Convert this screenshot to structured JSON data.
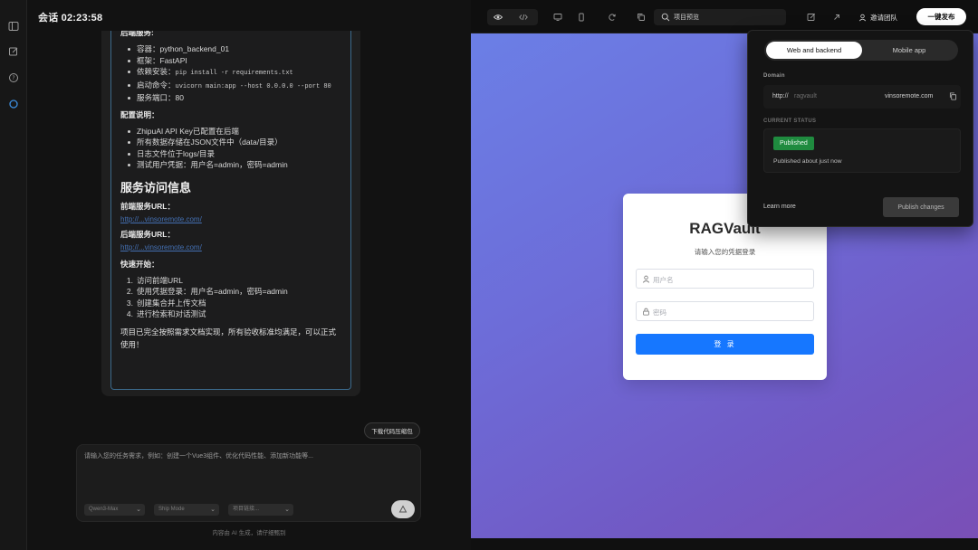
{
  "session": {
    "title": "会话 02:23:58"
  },
  "message": {
    "backend_heading": "后端服务:",
    "backend_items": [
      {
        "text": "容器：python_backend_01"
      },
      {
        "text": "框架：FastAPI"
      },
      {
        "prefix": "依赖安装：",
        "code": "pip install -r requirements.txt"
      },
      {
        "prefix": "启动命令：",
        "code": "uvicorn main:app --host 0.0.0.0 --port 80"
      },
      {
        "text": "服务端口：80"
      }
    ],
    "config_heading": "配置说明：",
    "config_items": [
      "ZhipuAI API Key已配置在后端",
      "所有数据存储在JSON文件中（data/目录）",
      "日志文件位于logs/目录",
      "测试用户凭据：用户名=admin，密码=admin"
    ],
    "service_heading": "服务访问信息",
    "frontend_url_label": "前端服务URL：",
    "frontend_url": "http://...vinsoremote.com/",
    "backend_url_label": "后端服务URL：",
    "backend_url": "http://...vinsoremote.com/",
    "quickstart_heading": "快速开始：",
    "quickstart_items": [
      "访问前端URL",
      "使用凭据登录：用户名=admin，密码=admin",
      "创建集合并上传文档",
      "进行检索和对话测试"
    ],
    "closing": "项目已完全按照需求文档实现，所有验收标准均满足，可以正式使用！"
  },
  "download_button": "下载代码压缩包",
  "composer": {
    "placeholder": "请输入您的任务需求，例如：创建一个Vue3组件、优化代码性能、添加新功能等...",
    "model_select": "Qwen3-Max",
    "mode_select": "Ship Mode",
    "project_select": "项目链接..."
  },
  "disclaimer": "内容由 AI 生成，请仔细甄别",
  "toolbar": {
    "address": "项目预览",
    "invite": "邀请团队",
    "publish": "一键发布"
  },
  "preview_app": {
    "title": "RAGVault",
    "subtitle": "请输入您的凭据登录",
    "username_placeholder": "用户名",
    "password_placeholder": "密码",
    "login_button": "登 录"
  },
  "publish_popover": {
    "tabs": [
      "Web and backend",
      "Mobile app"
    ],
    "active_tab": "Web and backend",
    "domain_label": "Domain",
    "domain_prefix": "http://",
    "domain_subdomain": "ragvault",
    "domain_suffix": "vinsoremote.com",
    "status_label": "CURRENT STATUS",
    "status_badge": "Published",
    "status_note": "Published about just now",
    "learn_more": "Learn more",
    "publish_changes": "Publish changes"
  }
}
